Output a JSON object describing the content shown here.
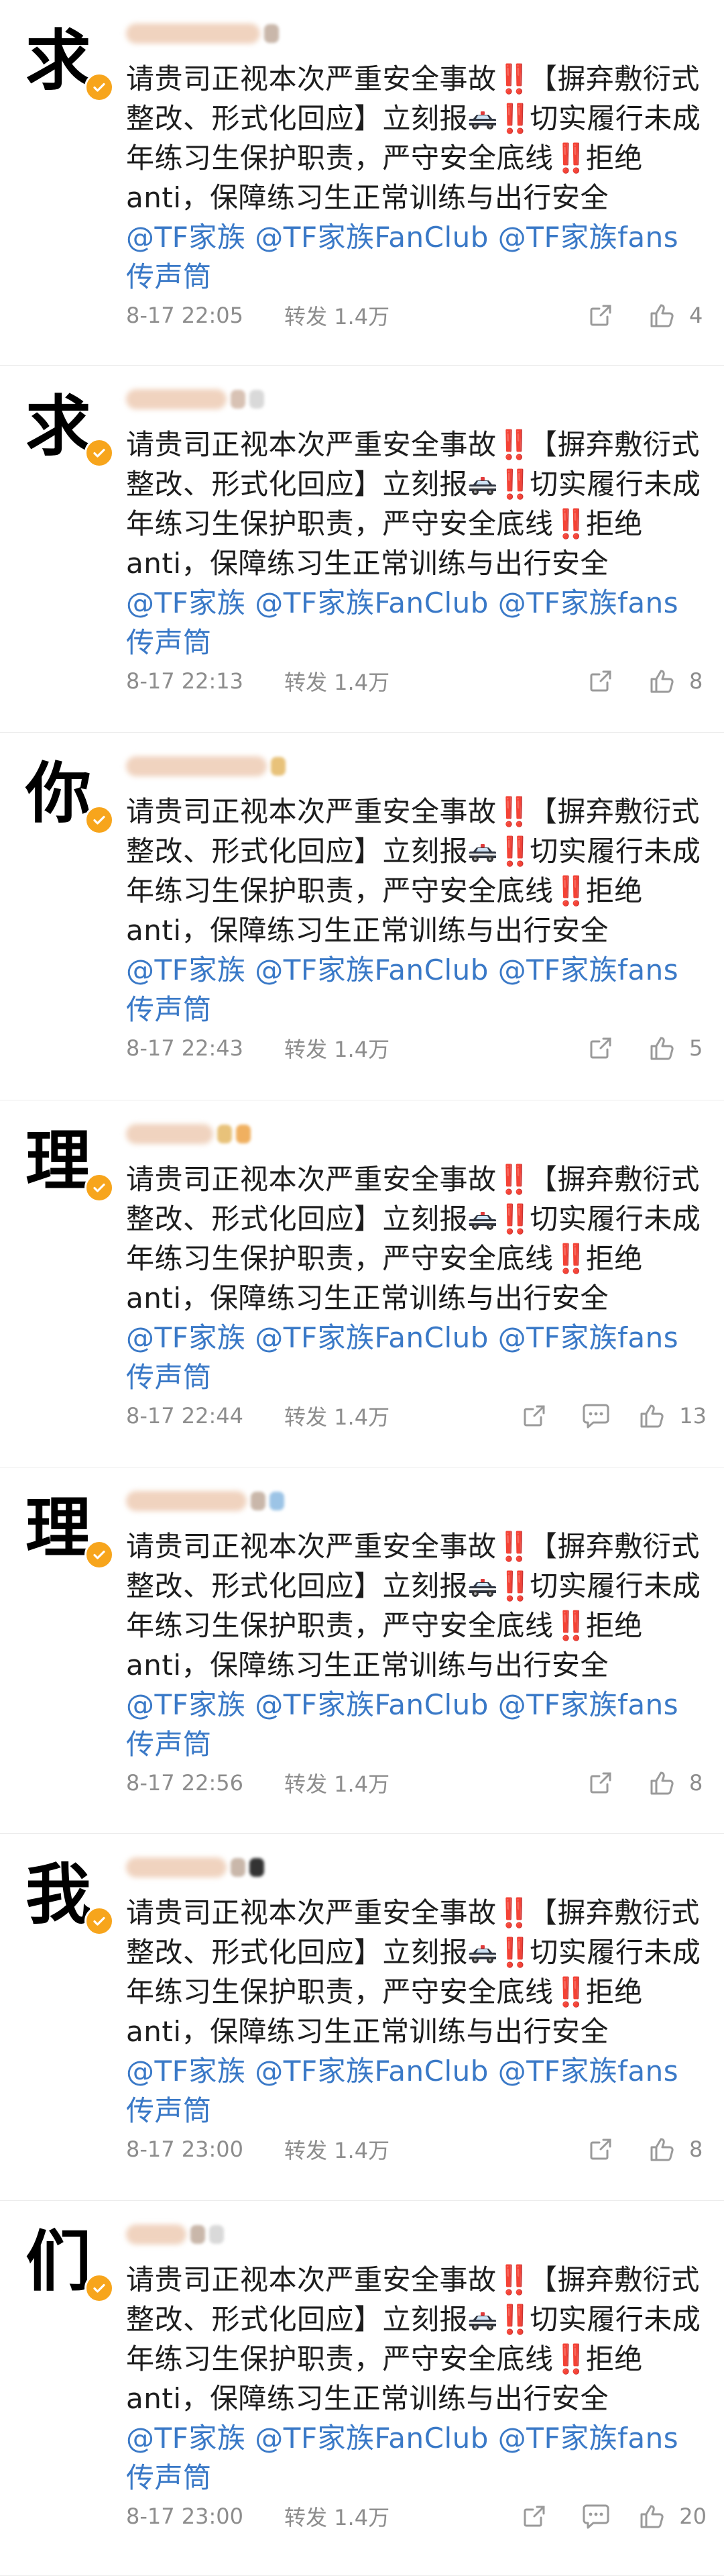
{
  "body_text": {
    "part1": "请贵司正视本次严重安全事故",
    "part2": "【摒弃敷衍式整改、形式化回应】立刻报",
    "part3": "切实履行未成年练习生保护职责，严守安全底线",
    "part4": "拒绝anti，保障练习生正常训练与出行安全",
    "mention1": "@TF家族",
    "mention2": "@TF家族FanClub",
    "mention3": "@TF家族fans传声筒",
    "double_exclamation": "‼️"
  },
  "repost_label": "转发 1.4万",
  "colors": {
    "mention": "#3a79c7",
    "badge": "#f7a51c",
    "alert": "#e23b3b"
  },
  "comments": [
    {
      "avatar_char": "求",
      "time": "8-17 22:05",
      "likes": "4",
      "show_reply_icon": false
    },
    {
      "avatar_char": "求",
      "time": "8-17 22:13",
      "likes": "8",
      "show_reply_icon": false
    },
    {
      "avatar_char": "你",
      "time": "8-17 22:43",
      "likes": "5",
      "show_reply_icon": false
    },
    {
      "avatar_char": "理",
      "time": "8-17 22:44",
      "likes": "13",
      "show_reply_icon": true
    },
    {
      "avatar_char": "理",
      "time": "8-17 22:56",
      "likes": "8",
      "show_reply_icon": false
    },
    {
      "avatar_char": "我",
      "time": "8-17 23:00",
      "likes": "8",
      "show_reply_icon": false
    },
    {
      "avatar_char": "们",
      "time": "8-17 23:00",
      "likes": "20",
      "show_reply_icon": true
    }
  ],
  "icons": [
    "verified-badge-icon",
    "share-icon",
    "comment-icon",
    "like-icon",
    "police-car-icon"
  ]
}
